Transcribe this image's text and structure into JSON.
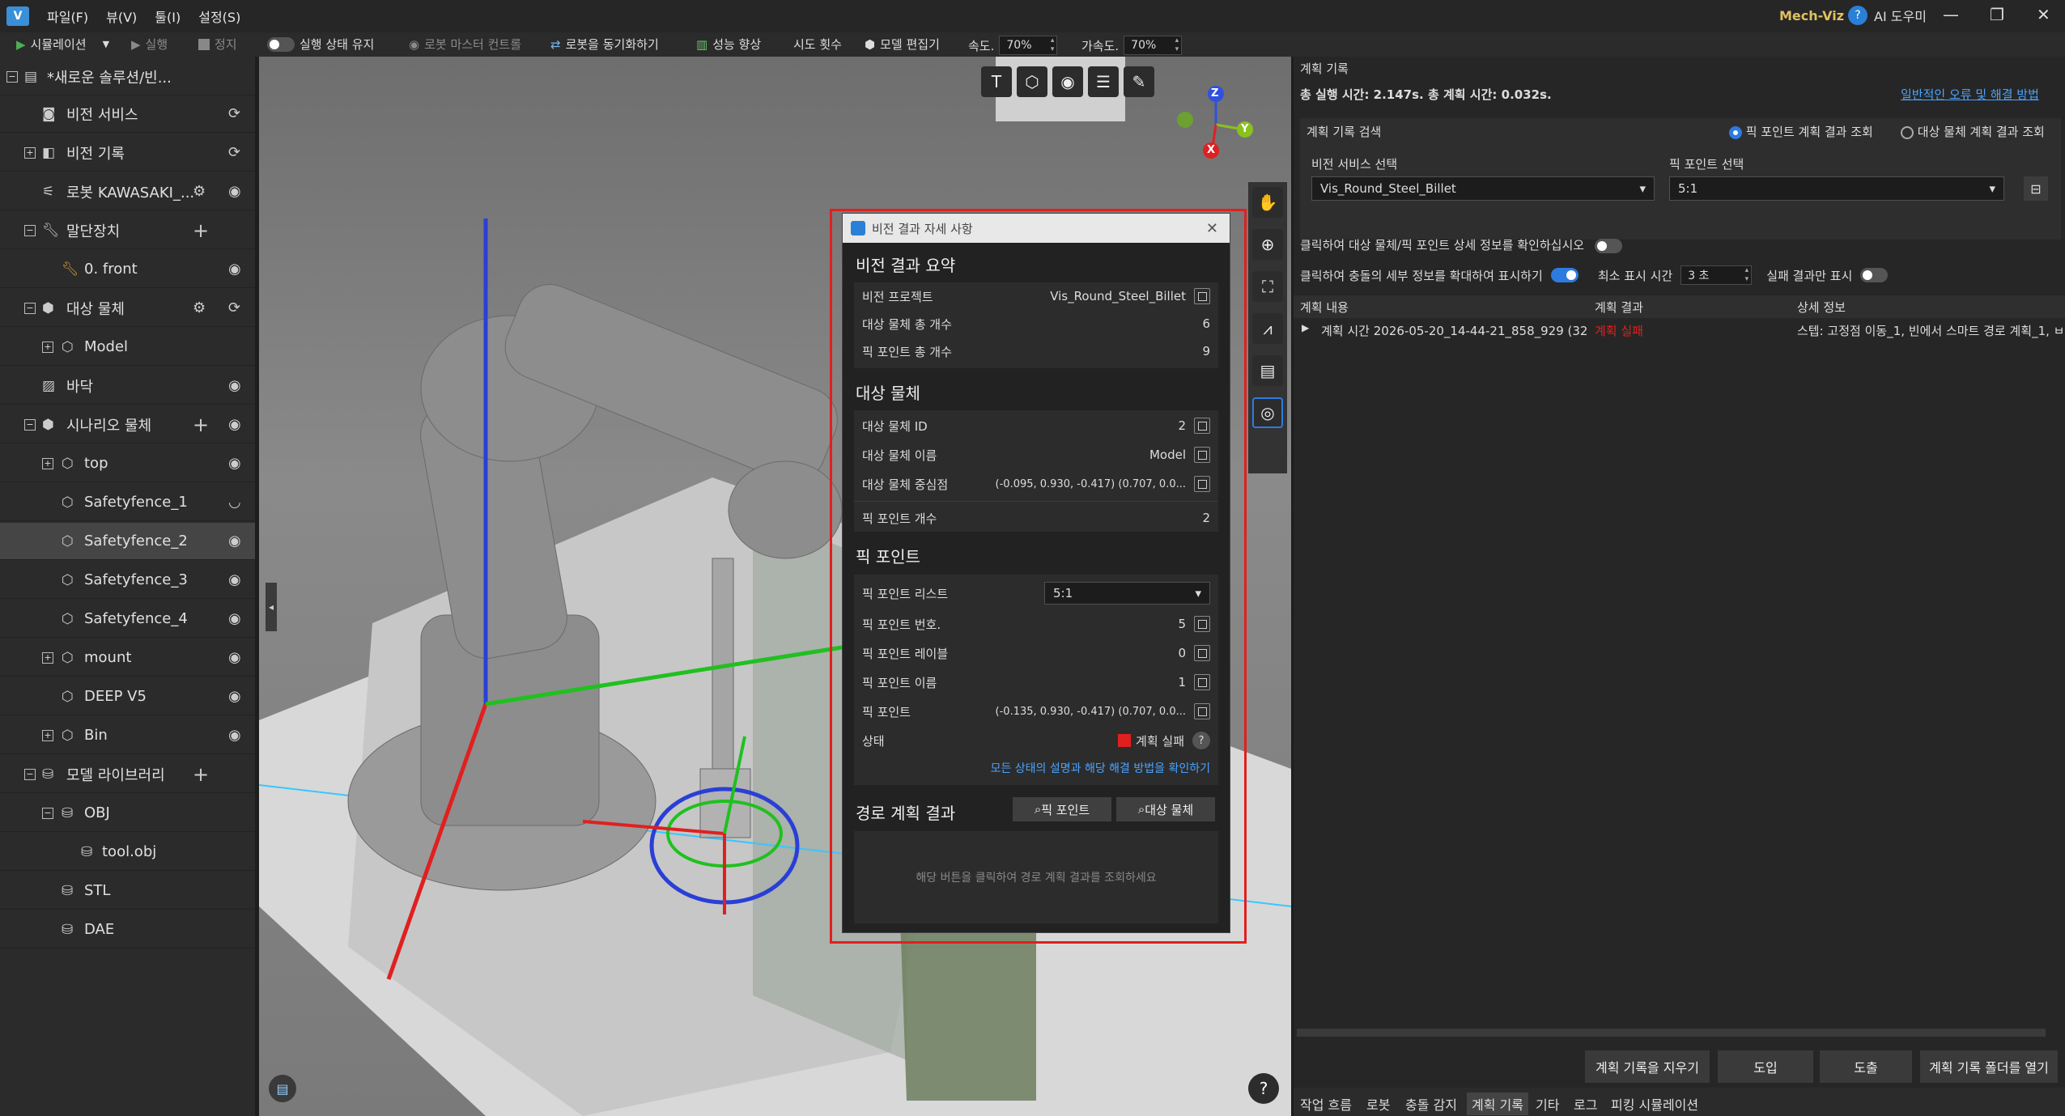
{
  "titlebar": {
    "menus": [
      "파일(F)",
      "뷰(V)",
      "툴(I)",
      "설정(S)"
    ],
    "app_name": "Mech-Viz",
    "ai_assistant": "AI 도우미"
  },
  "toolbar": {
    "simulate": "시뮬레이션",
    "run": "실행",
    "stop": "정지",
    "keep_state": "실행 상태 유지",
    "robot_master": "로봇 마스터 컨트롤",
    "sync_robot": "로봇을 동기화하기",
    "performance": "성능 향상",
    "attempts": "시도 횟수",
    "model_edit": "모델 편집기",
    "speed_label": "속도.",
    "speed_value": "70%",
    "accel_label": "가속도.",
    "accel_value": "70%"
  },
  "sidebar": {
    "items": [
      {
        "label": "*새로운 솔루션/빈..."
      },
      {
        "label": "비전 서비스"
      },
      {
        "label": "비전 기록"
      },
      {
        "label": "로봇 KAWASAKI_..."
      },
      {
        "label": "말단장치"
      },
      {
        "label": "0. front"
      },
      {
        "label": "대상 물체"
      },
      {
        "label": "Model"
      },
      {
        "label": "바닥"
      },
      {
        "label": "시나리오 물체"
      },
      {
        "label": "top"
      },
      {
        "label": "Safetyfence_1"
      },
      {
        "label": "Safetyfence_2"
      },
      {
        "label": "Safetyfence_3"
      },
      {
        "label": "Safetyfence_4"
      },
      {
        "label": "mount"
      },
      {
        "label": "DEEP V5"
      },
      {
        "label": "Bin"
      },
      {
        "label": "모델 라이브러리"
      },
      {
        "label": "OBJ"
      },
      {
        "label": "tool.obj"
      },
      {
        "label": "STL"
      },
      {
        "label": "DAE"
      }
    ]
  },
  "viewport": {
    "axis_z": "Z",
    "axis_y": "Y",
    "axis_x": "X",
    "help": "?"
  },
  "dialog": {
    "title": "비전 결과 자세 사항",
    "summary_title": "비전 결과 요약",
    "vision_project_label": "비전 프로젝트",
    "vision_project_value": "Vis_Round_Steel_Billet",
    "obj_total_label": "대상 물체 총 개수",
    "obj_total_value": "6",
    "pick_total_label": "픽 포인트 총 개수",
    "pick_total_value": "9",
    "target_title": "대상 물체",
    "obj_id_label": "대상 물체 ID",
    "obj_id_value": "2",
    "obj_name_label": "대상 물체 이름",
    "obj_name_value": "Model",
    "obj_center_label": "대상 물체 중심점",
    "obj_center_value": "(-0.095, 0.930, -0.417) (0.707, 0.0...",
    "pick_count_label": "픽 포인트 개수",
    "pick_count_value": "2",
    "pick_title": "픽 포인트",
    "pick_list_label": "픽 포인트 리스트",
    "pick_list_value": "5:1",
    "pick_no_label": "픽 포인트 번호.",
    "pick_no_value": "5",
    "pick_layer_label": "픽 포인트 레이블",
    "pick_layer_value": "0",
    "pick_name_label": "픽 포인트 이름",
    "pick_name_value": "1",
    "pick_label": "픽 포인트",
    "pick_value": "(-0.135, 0.930, -0.417) (0.707, 0.0...",
    "status_label": "상태",
    "status_value": "계획 실패",
    "status_link": "모든 상태의 설명과 해당 해결 방법을 확인하기",
    "path_title": "경로 계획 결과",
    "btn_pick": "픽 포인트",
    "btn_obj": "대상 물체",
    "path_hint": "해당 버튼을 클릭하여 경로 계획 결과를 조회하세요"
  },
  "right": {
    "header": "계획 기록",
    "summary": "총 실행 시간: 2.147s. 총 계획 시간: 0.032s.",
    "help_link": "일반적인 오류 및 해결 방법",
    "search_label": "계획 기록 검색",
    "radio_pick": "픽 포인트 계획 결과 조회",
    "radio_obj": "대상 물체 계획 결과 조회",
    "vision_select_label": "비전 서비스 선택",
    "vision_select_value": "Vis_Round_Steel_Billet",
    "pick_select_label": "픽 포인트 선택",
    "pick_select_value": "5:1",
    "detail_toggle": "클릭하여 대상 물체/픽 포인트 상세 정보를 확인하십시오",
    "collision_toggle": "클릭하여 충돌의 세부 정보를 확대하여 표시하기",
    "min_time_label": "최소 표시 시간",
    "min_time_value": "3 초",
    "fail_only": "실패 결과만 표시",
    "col_content": "계획 내용",
    "col_result": "계획 결과",
    "col_detail": "상세 정보",
    "row_content": "계획 시간 2026-05-20_14-44-21_858_929 (32...",
    "row_result": "계획 실패",
    "row_detail": "스텝: 고정점 이동_1, 빈에서 스마트 경로 계획_1, ㅂ",
    "btn_clear": "계획 기록을 지우기",
    "btn_import": "도입",
    "btn_export": "도출",
    "btn_open": "계획 기록 폴더를 열기",
    "tabs": [
      "작업 흐름",
      "로봇",
      "충돌 감지",
      "계획 기록",
      "기타",
      "로그",
      "피킹 시뮬레이션"
    ]
  },
  "colors": {
    "accent": "#2d7be0",
    "fail": "#e0201f",
    "highlight_box": "#e0201f"
  }
}
